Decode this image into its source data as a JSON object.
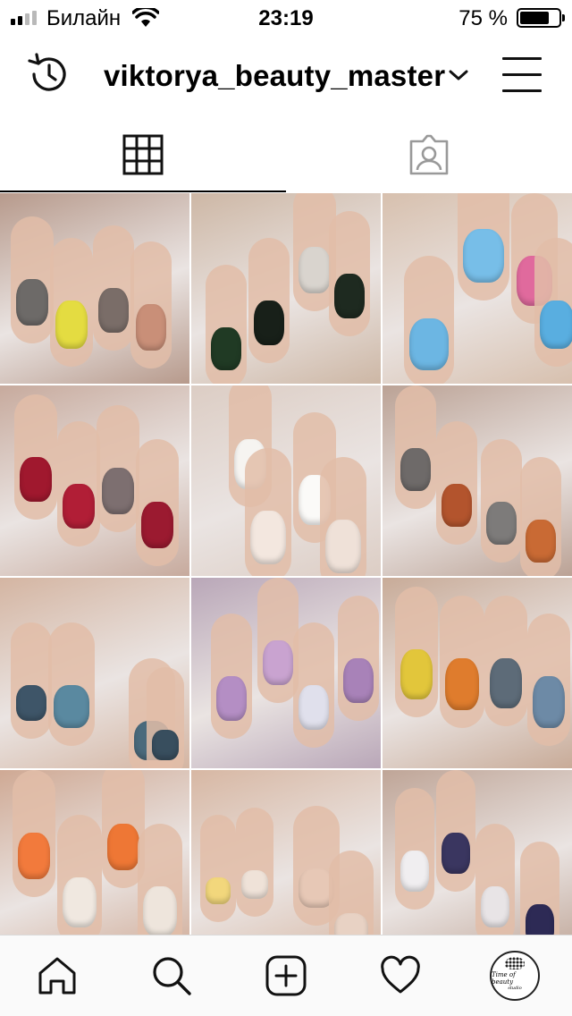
{
  "status_bar": {
    "carrier": "Билайн",
    "time": "23:19",
    "battery_percent": "75 %",
    "battery_level": 0.75
  },
  "header": {
    "username": "viktorya_beauty_master",
    "icons": {
      "left": "history-icon",
      "dropdown": "chevron-down-icon",
      "right": "menu-icon"
    }
  },
  "tabs": [
    {
      "icon": "grid-icon",
      "active": true
    },
    {
      "icon": "tagged-icon",
      "active": false
    }
  ],
  "grid": {
    "posts": [
      {
        "bg": "#b79a8c",
        "nails": [
          "#6d6a68",
          "#e4dc41",
          "#7a6d68",
          "#c98f78"
        ]
      },
      {
        "bg": "#cdb7a5",
        "nails": [
          "#203a24",
          "#182019",
          "#d9d4ce",
          "#1e2a20"
        ]
      },
      {
        "bg": "#d7c0ae",
        "nails": [
          "#6cb6e3",
          "#77bee8",
          "#e06a9d",
          "#59aee0"
        ]
      },
      {
        "bg": "#c7aa9d",
        "nails": [
          "#a0182e",
          "#b11e36",
          "#7d6f70",
          "#9b1a30"
        ]
      },
      {
        "bg": "#dccdc4",
        "nails": [
          "#f6f4f1",
          "#f3e7df",
          "#fbfaf8",
          "#efe1d8"
        ]
      },
      {
        "bg": "#bba295",
        "nails": [
          "#6e6a69",
          "#b3542d",
          "#7d7b7a",
          "#c96a34"
        ]
      },
      {
        "bg": "#d4b5a2",
        "nails": [
          "#3e5568",
          "#5a89a0",
          "#4a6a7c",
          "#384e5e"
        ]
      },
      {
        "bg": "#b9a7b8",
        "nails": [
          "#b48ec4",
          "#c9a3d0",
          "#e0e0ec",
          "#a882b8"
        ]
      },
      {
        "bg": "#c8ab98",
        "nails": [
          "#e2c63b",
          "#df7c2d",
          "#5d6b78",
          "#6d8aa6"
        ]
      },
      {
        "bg": "#cfa994",
        "nails": [
          "#f27a3c",
          "#f0e8e0",
          "#ee7735",
          "#eee5dc"
        ]
      },
      {
        "bg": "#d7b7a3",
        "nails": [
          "#f2d77c",
          "#efe2d8",
          "#e7c8b6",
          "#e8d2c4"
        ]
      },
      {
        "bg": "#bfa597",
        "nails": [
          "#f0eef0",
          "#3a3660",
          "#e8e4e6",
          "#2d2a55"
        ]
      }
    ]
  },
  "bottom_nav": {
    "items": [
      "home-icon",
      "search-icon",
      "new-post-icon",
      "activity-heart-icon",
      "profile-avatar"
    ],
    "avatar_text": "Time of beauty",
    "avatar_sub": "studio"
  }
}
